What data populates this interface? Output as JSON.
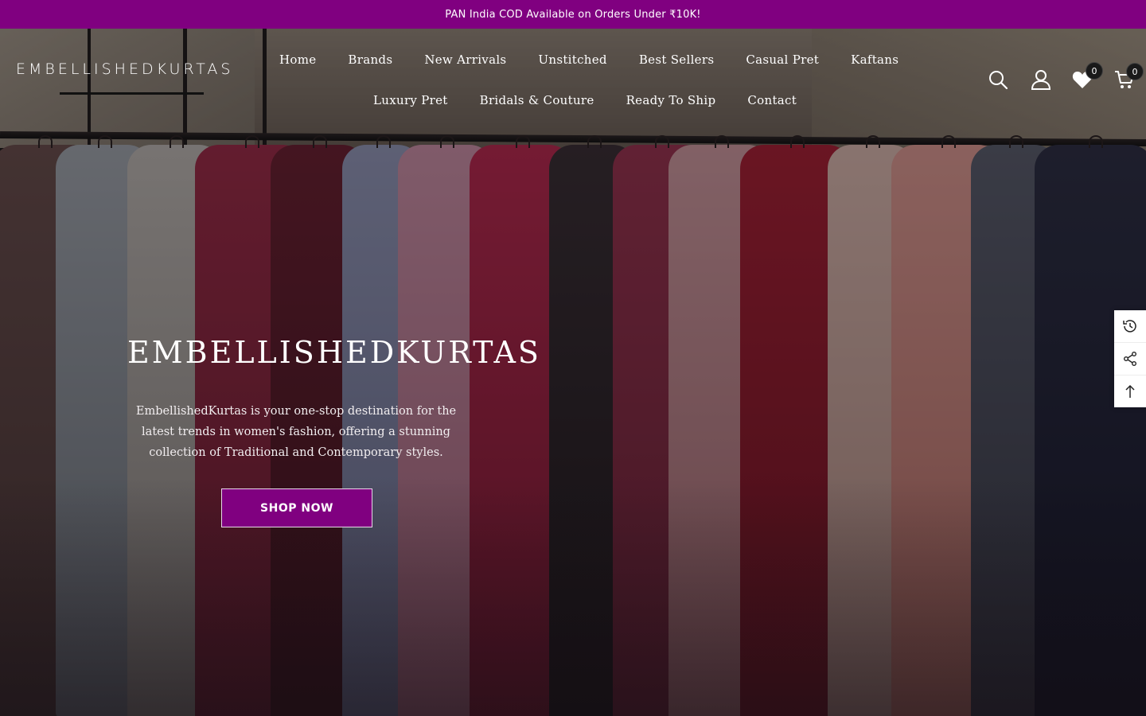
{
  "announcement": {
    "text": "PAN India COD Available on Orders Under ₹10K!"
  },
  "brand": {
    "logo_text": "EMBELLISHEDKURTAS"
  },
  "nav": {
    "row1": [
      "Home",
      "Brands",
      "New Arrivals",
      "Unstitched",
      "Best Sellers",
      "Casual Pret",
      "Kaftans"
    ],
    "row2": [
      "Luxury Pret",
      "Bridals & Couture",
      "Ready To Ship",
      "Contact"
    ]
  },
  "header_icons": {
    "search": "search-icon",
    "account": "user-icon",
    "wishlist": "heart-icon",
    "wishlist_count": "0",
    "cart": "cart-icon",
    "cart_count": "0"
  },
  "hero": {
    "title": "EMBELLISHEDKURTAS",
    "description": "EmbellishedKurtas is your one-stop destination for the latest trends in women's fashion, offering a stunning collection of Traditional and Contemporary styles.",
    "cta_label": "SHOP NOW"
  },
  "side_tools": [
    "recently-viewed-icon",
    "share-icon",
    "back-to-top-icon"
  ],
  "colors": {
    "accent": "#800080",
    "text_light": "#ffffff"
  }
}
